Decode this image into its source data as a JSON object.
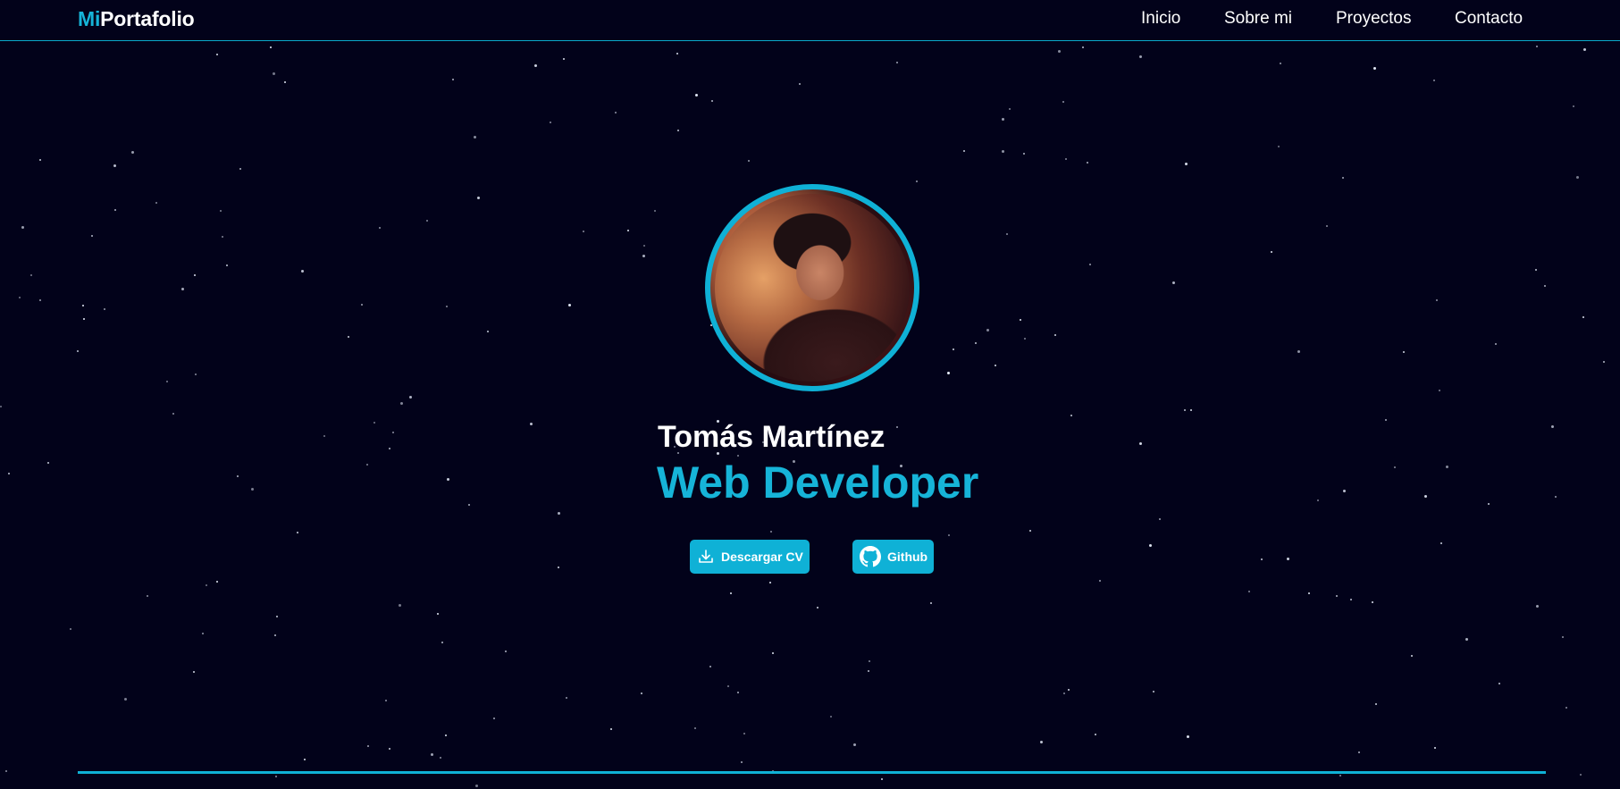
{
  "header": {
    "logo": {
      "prefix": "Mi",
      "suffix": "Portafolio"
    },
    "nav": [
      "Inicio",
      "Sobre mi",
      "Proyectos",
      "Contacto"
    ]
  },
  "hero": {
    "avatar_alt_icon": "profile-photo",
    "name": "Tomás Martínez",
    "role": "Web Developer",
    "buttons": {
      "cv": {
        "label": "Descargar CV",
        "icon": "download-icon"
      },
      "github": {
        "label": "Github",
        "icon": "github-icon"
      }
    }
  },
  "colors": {
    "background": "#02021a",
    "accent": "#0fb1d6",
    "text": "#ffffff"
  }
}
